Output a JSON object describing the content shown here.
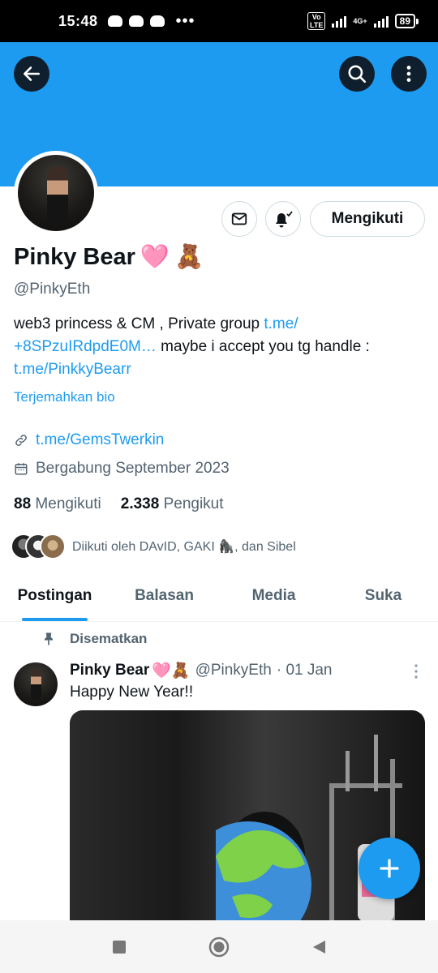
{
  "status_bar": {
    "time": "15:48",
    "more_notifications": "•••",
    "volte": "Vo\nLTE",
    "network": "4G+",
    "battery": "89"
  },
  "profile": {
    "name": "Pinky Bear",
    "name_emojis": [
      "🩷",
      "🧸"
    ],
    "handle": "@PinkyEth",
    "bio_text_1": "web3 princess & CM , Private group ",
    "bio_link_1": "t.me/\n+8SPzuIRdpdE0M…",
    "bio_text_2": " maybe i accept you tg handle : ",
    "bio_link_2": "t.me/PinkkyBearr",
    "translate_bio": "Terjemahkan bio",
    "url": "t.me/GemsTwerkin",
    "joined": "Bergabung September 2023",
    "following_count": "88",
    "following_label": "Mengikuti",
    "followers_count": "2.338",
    "followers_label": "Pengikut",
    "followed_by": "Diikuti oleh DAvID, GAKI 🦍, dan Sibel"
  },
  "actions": {
    "follow_button": "Mengikuti"
  },
  "tabs": [
    {
      "label": "Postingan",
      "active": true
    },
    {
      "label": "Balasan",
      "active": false
    },
    {
      "label": "Media",
      "active": false
    },
    {
      "label": "Suka",
      "active": false
    }
  ],
  "pinned_post": {
    "pinned_label": "Disematkan",
    "author_name": "Pinky Bear",
    "author_emojis": "🩷🧸",
    "author_handle": "@PinkyEth",
    "date": "· 01 Jan",
    "text": "Happy New Year!!"
  },
  "colors": {
    "accent": "#1d9bf0",
    "text_primary": "#0f1419",
    "text_secondary": "#536471",
    "banner": "#1d9bf0"
  },
  "icons": {
    "back": "arrow-left-icon",
    "search": "search-icon",
    "more": "more-vertical-icon",
    "mail": "mail-icon",
    "bell": "bell-subscribed-icon",
    "link": "link-icon",
    "calendar": "calendar-icon",
    "pin": "pin-icon",
    "compose": "plus-icon"
  }
}
